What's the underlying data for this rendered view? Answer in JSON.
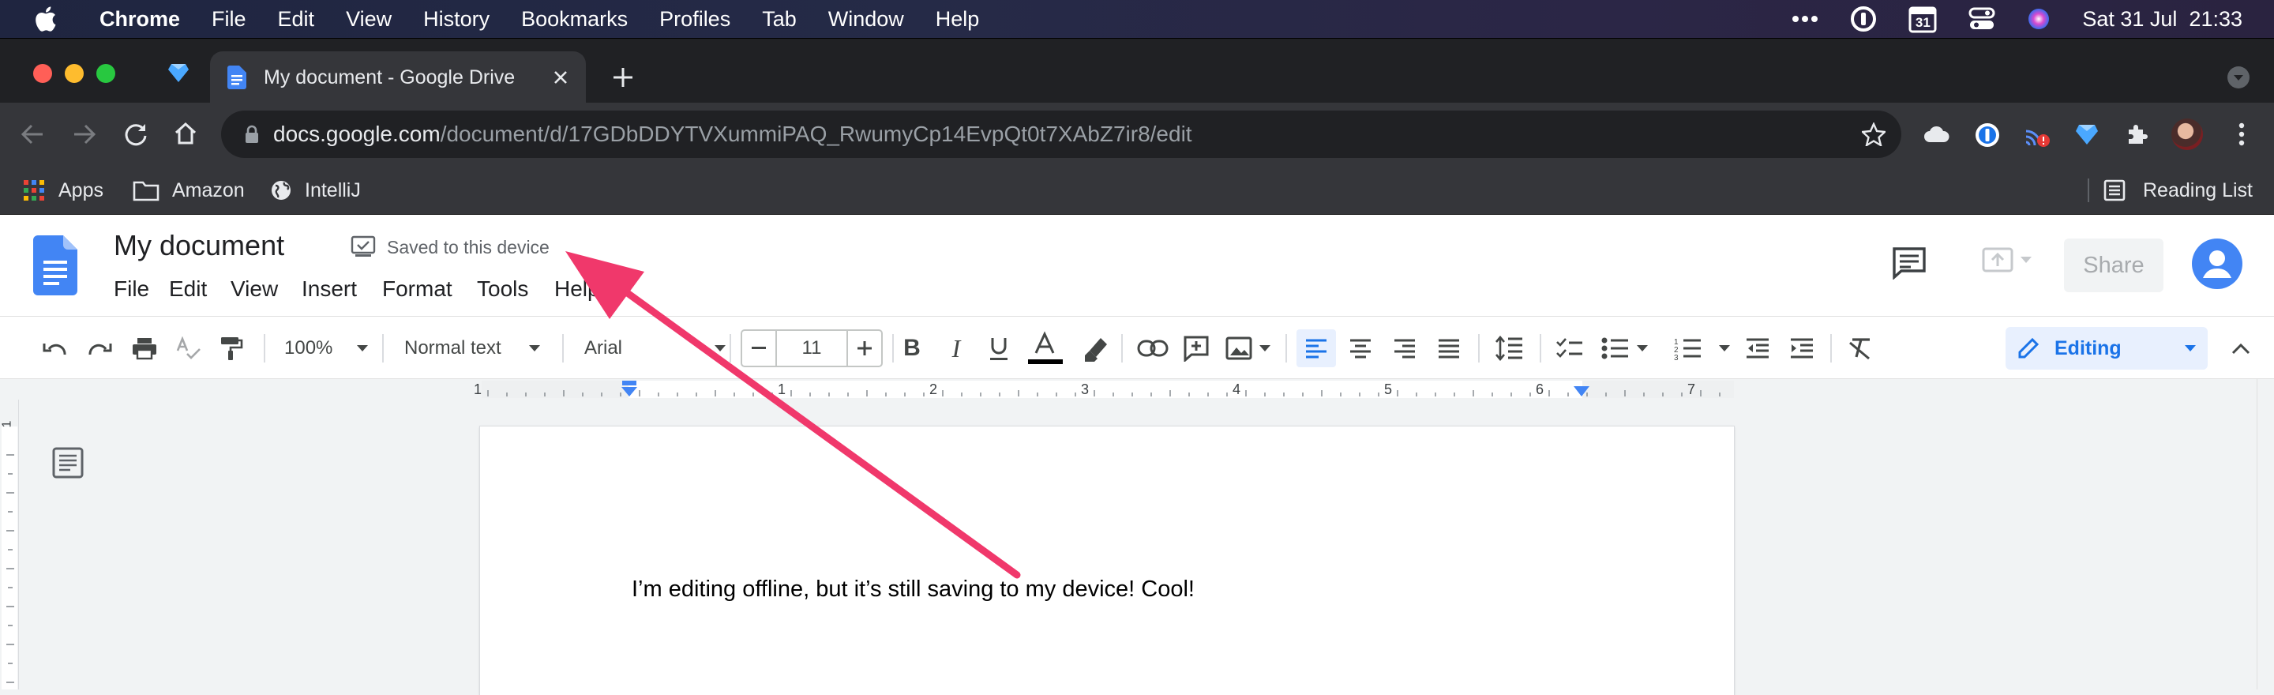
{
  "menubar": {
    "app": "Chrome",
    "items": [
      "File",
      "Edit",
      "View",
      "History",
      "Bookmarks",
      "Profiles",
      "Tab",
      "Window",
      "Help"
    ],
    "calendar_day": "31",
    "clock": "Sat 31 Jul  21:33"
  },
  "browser": {
    "tab_title": "My document - Google Drive",
    "url_host": "docs.google.com",
    "url_path": "/document/d/17GDbDDYTVXummiPAQ_RwumyCp14EvpQt0t7XAbZ7ir8/edit",
    "bookmarks": [
      "Apps",
      "Amazon",
      "IntelliJ"
    ],
    "reading_list": "Reading List"
  },
  "doc": {
    "title": "My document",
    "save_status": "Saved to this device",
    "menu": [
      "File",
      "Edit",
      "View",
      "Insert",
      "Format",
      "Tools",
      "Help"
    ],
    "share_label": "Share",
    "zoom": "100%",
    "style": "Normal text",
    "font": "Arial",
    "font_size": "11",
    "mode": "Editing",
    "body_text": "I’m editing offline, but it’s still saving to my device! Cool!",
    "ruler_numbers": [
      "1",
      "1",
      "2",
      "3",
      "4",
      "5",
      "6",
      "7"
    ],
    "vruler_number": "1"
  },
  "colors": {
    "docs_blue": "#4285f4",
    "arrow_pink": "#f0386b",
    "editing_bg": "#e8f0fe",
    "editing_fg": "#1a73e8"
  }
}
